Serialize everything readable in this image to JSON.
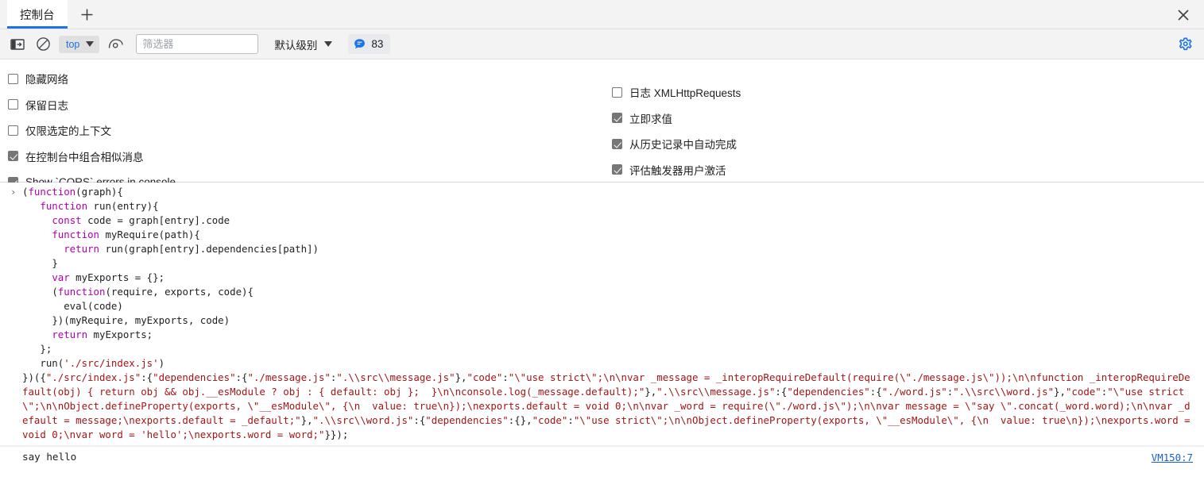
{
  "window": {
    "close_icon": "close-icon"
  },
  "tabbar": {
    "tabs": [
      {
        "label": "控制台",
        "active": true
      }
    ],
    "new_tab_icon": "plus-icon"
  },
  "toolbar": {
    "sidebar_toggle_icon": "panel-toggle-icon",
    "clear_console_icon": "clear-console-icon",
    "context_value": "top",
    "context_caret_icon": "chevron-down-icon",
    "eye_icon": "live-expression-eye-icon",
    "filter_placeholder": "筛选器",
    "filter_value": "",
    "level_label": "默认级别",
    "level_caret_icon": "chevron-down-icon",
    "message_badge_icon": "message-bubble-icon",
    "message_count": "83",
    "settings_icon": "gear-icon",
    "accent_color": "#1a73e8"
  },
  "settings": {
    "left_column": [
      {
        "label": "隐藏网络",
        "checked": false
      },
      {
        "label": "保留日志",
        "checked": false
      },
      {
        "label": "仅限选定的上下文",
        "checked": false
      },
      {
        "label": "在控制台中组合相似消息",
        "checked": true
      },
      {
        "label": "Show `CORS` errors in console",
        "checked": true
      }
    ],
    "right_column": [
      {
        "label": "日志 XMLHttpRequests",
        "checked": false
      },
      {
        "label": "立即求值",
        "checked": true
      },
      {
        "label": "从历史记录中自动完成",
        "checked": true
      },
      {
        "label": "评估触发器用户激活",
        "checked": true
      }
    ]
  },
  "console": {
    "expand_arrow": "›",
    "code_tokens": [
      {
        "t": "plain",
        "v": "("
      },
      {
        "t": "kw",
        "v": "function"
      },
      {
        "t": "plain",
        "v": "(graph){\n   "
      },
      {
        "t": "kw",
        "v": "function"
      },
      {
        "t": "plain",
        "v": " run(entry){\n     "
      },
      {
        "t": "kw",
        "v": "const"
      },
      {
        "t": "plain",
        "v": " code = graph[entry].code\n     "
      },
      {
        "t": "kw",
        "v": "function"
      },
      {
        "t": "plain",
        "v": " myRequire(path){\n       "
      },
      {
        "t": "kw",
        "v": "return"
      },
      {
        "t": "plain",
        "v": " run(graph[entry].dependencies[path])\n     }\n     "
      },
      {
        "t": "kw",
        "v": "var"
      },
      {
        "t": "plain",
        "v": " myExports = {};\n     ("
      },
      {
        "t": "kw",
        "v": "function"
      },
      {
        "t": "plain",
        "v": "(require, exports, code){\n       eval(code)\n     })(myRequire, myExports, code)\n     "
      },
      {
        "t": "kw",
        "v": "return"
      },
      {
        "t": "plain",
        "v": " myExports;\n   };\n   run("
      },
      {
        "t": "str",
        "v": "'./src/index.js'"
      },
      {
        "t": "plain",
        "v": ")\n})({"
      },
      {
        "t": "str",
        "v": "\"./src/index.js\""
      },
      {
        "t": "plain",
        "v": ":{"
      },
      {
        "t": "str",
        "v": "\"dependencies\""
      },
      {
        "t": "plain",
        "v": ":{"
      },
      {
        "t": "str",
        "v": "\"./message.js\""
      },
      {
        "t": "plain",
        "v": ":"
      },
      {
        "t": "str",
        "v": "\".\\\\src\\\\message.js\""
      },
      {
        "t": "plain",
        "v": "},"
      },
      {
        "t": "str",
        "v": "\"code\""
      },
      {
        "t": "plain",
        "v": ":"
      },
      {
        "t": "str",
        "v": "\"\\\"use strict\\\";\\n\\nvar _message = _interopRequireDefault(require(\\\"./message.js\\\"));\\n\\nfunction _interopRequireDefault(obj) { return obj && obj.__esModule ? obj : { default: obj };  }\\n\\nconsole.log(_message.default);\""
      },
      {
        "t": "plain",
        "v": "},"
      },
      {
        "t": "str",
        "v": "\".\\\\src\\\\message.js\""
      },
      {
        "t": "plain",
        "v": ":{"
      },
      {
        "t": "str",
        "v": "\"dependencies\""
      },
      {
        "t": "plain",
        "v": ":{"
      },
      {
        "t": "str",
        "v": "\"./word.js\""
      },
      {
        "t": "plain",
        "v": ":"
      },
      {
        "t": "str",
        "v": "\".\\\\src\\\\word.js\""
      },
      {
        "t": "plain",
        "v": "},"
      },
      {
        "t": "str",
        "v": "\"code\""
      },
      {
        "t": "plain",
        "v": ":"
      },
      {
        "t": "str",
        "v": "\"\\\"use strict\\\";\\n\\nObject.defineProperty(exports, \\\"__esModule\\\", {\\n  value: true\\n});\\nexports.default = void 0;\\n\\nvar _word = require(\\\"./word.js\\\");\\n\\nvar message = \\\"say \\\".concat(_word.word);\\n\\nvar _default = message;\\nexports.default = _default;\""
      },
      {
        "t": "plain",
        "v": "},"
      },
      {
        "t": "str",
        "v": "\".\\\\src\\\\word.js\""
      },
      {
        "t": "plain",
        "v": ":{"
      },
      {
        "t": "str",
        "v": "\"dependencies\""
      },
      {
        "t": "plain",
        "v": ":{},"
      },
      {
        "t": "str",
        "v": "\"code\""
      },
      {
        "t": "plain",
        "v": ":"
      },
      {
        "t": "str",
        "v": "\"\\\"use strict\\\";\\n\\nObject.defineProperty(exports, \\\"__esModule\\\", {\\n  value: true\\n});\\nexports.word = void 0;\\nvar word = 'hello';\\nexports.word = word;\""
      },
      {
        "t": "plain",
        "v": "}});"
      }
    ],
    "result_text": "say hello",
    "source_link": "VM150:7"
  }
}
